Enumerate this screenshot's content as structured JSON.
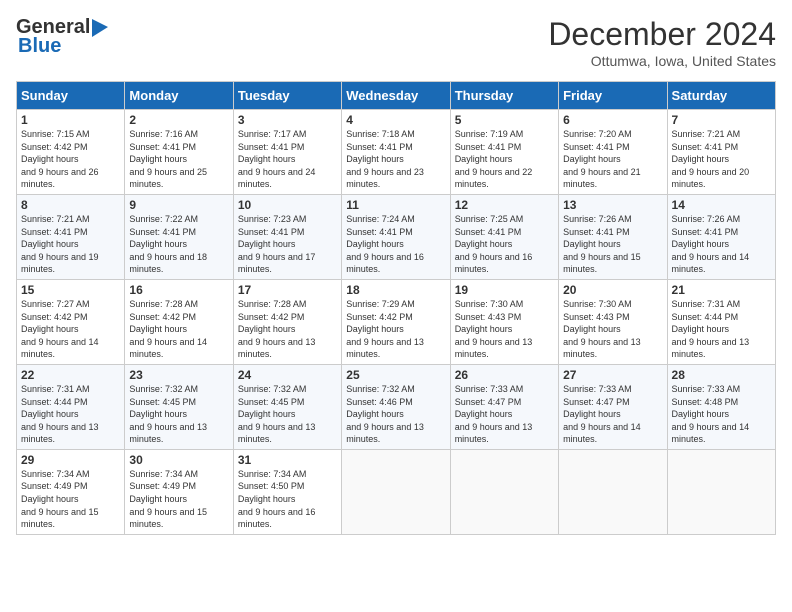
{
  "logo": {
    "line1": "General",
    "line2": "Blue"
  },
  "title": "December 2024",
  "location": "Ottumwa, Iowa, United States",
  "days_header": [
    "Sunday",
    "Monday",
    "Tuesday",
    "Wednesday",
    "Thursday",
    "Friday",
    "Saturday"
  ],
  "weeks": [
    [
      {
        "day": "1",
        "sunrise": "7:15 AM",
        "sunset": "4:42 PM",
        "daylight": "9 hours and 26 minutes."
      },
      {
        "day": "2",
        "sunrise": "7:16 AM",
        "sunset": "4:41 PM",
        "daylight": "9 hours and 25 minutes."
      },
      {
        "day": "3",
        "sunrise": "7:17 AM",
        "sunset": "4:41 PM",
        "daylight": "9 hours and 24 minutes."
      },
      {
        "day": "4",
        "sunrise": "7:18 AM",
        "sunset": "4:41 PM",
        "daylight": "9 hours and 23 minutes."
      },
      {
        "day": "5",
        "sunrise": "7:19 AM",
        "sunset": "4:41 PM",
        "daylight": "9 hours and 22 minutes."
      },
      {
        "day": "6",
        "sunrise": "7:20 AM",
        "sunset": "4:41 PM",
        "daylight": "9 hours and 21 minutes."
      },
      {
        "day": "7",
        "sunrise": "7:21 AM",
        "sunset": "4:41 PM",
        "daylight": "9 hours and 20 minutes."
      }
    ],
    [
      {
        "day": "8",
        "sunrise": "7:21 AM",
        "sunset": "4:41 PM",
        "daylight": "9 hours and 19 minutes."
      },
      {
        "day": "9",
        "sunrise": "7:22 AM",
        "sunset": "4:41 PM",
        "daylight": "9 hours and 18 minutes."
      },
      {
        "day": "10",
        "sunrise": "7:23 AM",
        "sunset": "4:41 PM",
        "daylight": "9 hours and 17 minutes."
      },
      {
        "day": "11",
        "sunrise": "7:24 AM",
        "sunset": "4:41 PM",
        "daylight": "9 hours and 16 minutes."
      },
      {
        "day": "12",
        "sunrise": "7:25 AM",
        "sunset": "4:41 PM",
        "daylight": "9 hours and 16 minutes."
      },
      {
        "day": "13",
        "sunrise": "7:26 AM",
        "sunset": "4:41 PM",
        "daylight": "9 hours and 15 minutes."
      },
      {
        "day": "14",
        "sunrise": "7:26 AM",
        "sunset": "4:41 PM",
        "daylight": "9 hours and 14 minutes."
      }
    ],
    [
      {
        "day": "15",
        "sunrise": "7:27 AM",
        "sunset": "4:42 PM",
        "daylight": "9 hours and 14 minutes."
      },
      {
        "day": "16",
        "sunrise": "7:28 AM",
        "sunset": "4:42 PM",
        "daylight": "9 hours and 14 minutes."
      },
      {
        "day": "17",
        "sunrise": "7:28 AM",
        "sunset": "4:42 PM",
        "daylight": "9 hours and 13 minutes."
      },
      {
        "day": "18",
        "sunrise": "7:29 AM",
        "sunset": "4:42 PM",
        "daylight": "9 hours and 13 minutes."
      },
      {
        "day": "19",
        "sunrise": "7:30 AM",
        "sunset": "4:43 PM",
        "daylight": "9 hours and 13 minutes."
      },
      {
        "day": "20",
        "sunrise": "7:30 AM",
        "sunset": "4:43 PM",
        "daylight": "9 hours and 13 minutes."
      },
      {
        "day": "21",
        "sunrise": "7:31 AM",
        "sunset": "4:44 PM",
        "daylight": "9 hours and 13 minutes."
      }
    ],
    [
      {
        "day": "22",
        "sunrise": "7:31 AM",
        "sunset": "4:44 PM",
        "daylight": "9 hours and 13 minutes."
      },
      {
        "day": "23",
        "sunrise": "7:32 AM",
        "sunset": "4:45 PM",
        "daylight": "9 hours and 13 minutes."
      },
      {
        "day": "24",
        "sunrise": "7:32 AM",
        "sunset": "4:45 PM",
        "daylight": "9 hours and 13 minutes."
      },
      {
        "day": "25",
        "sunrise": "7:32 AM",
        "sunset": "4:46 PM",
        "daylight": "9 hours and 13 minutes."
      },
      {
        "day": "26",
        "sunrise": "7:33 AM",
        "sunset": "4:47 PM",
        "daylight": "9 hours and 13 minutes."
      },
      {
        "day": "27",
        "sunrise": "7:33 AM",
        "sunset": "4:47 PM",
        "daylight": "9 hours and 14 minutes."
      },
      {
        "day": "28",
        "sunrise": "7:33 AM",
        "sunset": "4:48 PM",
        "daylight": "9 hours and 14 minutes."
      }
    ],
    [
      {
        "day": "29",
        "sunrise": "7:34 AM",
        "sunset": "4:49 PM",
        "daylight": "9 hours and 15 minutes."
      },
      {
        "day": "30",
        "sunrise": "7:34 AM",
        "sunset": "4:49 PM",
        "daylight": "9 hours and 15 minutes."
      },
      {
        "day": "31",
        "sunrise": "7:34 AM",
        "sunset": "4:50 PM",
        "daylight": "9 hours and 16 minutes."
      },
      null,
      null,
      null,
      null
    ]
  ]
}
